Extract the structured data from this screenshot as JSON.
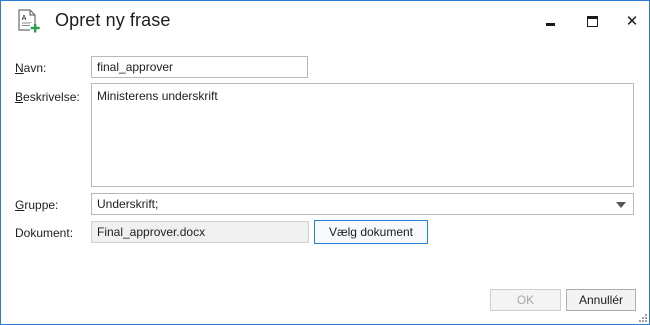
{
  "window": {
    "title": "Opret ny frase",
    "title_icon": "document-add-icon",
    "controls": {
      "minimize": "minimize-icon",
      "maximize": "maximize-icon",
      "close": "✕"
    },
    "border_color": "#2b7cd3"
  },
  "form": {
    "name": {
      "label_hotkey": "N",
      "label_rest": "avn:",
      "value": "final_approver"
    },
    "description": {
      "label_hotkey": "B",
      "label_rest": "eskrivelse:",
      "value": "Ministerens underskrift"
    },
    "group": {
      "label_hotkey": "G",
      "label_rest": "ruppe:",
      "value": "Underskrift;"
    },
    "document": {
      "label": "Dokument:",
      "value": "Final_approver.docx",
      "choose_button": "Vælg dokument"
    }
  },
  "footer": {
    "ok_label": "OK",
    "cancel_label": "Annullér"
  }
}
